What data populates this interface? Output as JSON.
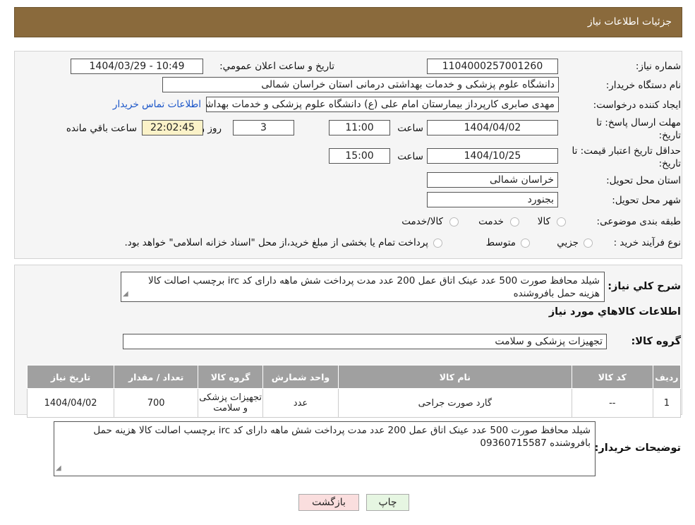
{
  "header": {
    "title": "جزئیات اطلاعات نیاز"
  },
  "fields": {
    "need_number_label": "شماره نیاز:",
    "need_number": "1104000257001260",
    "announce_label": "تاریخ و ساعت اعلان عمومي:",
    "announce_value": "1404/03/29 - 10:49",
    "buyer_org_label": "نام دستگاه خریدار:",
    "buyer_org": "دانشگاه علوم پزشکی و خدمات بهداشتی درمانی استان خراسان شمالی",
    "creator_label": "ایجاد کننده درخواست:",
    "creator": "مهدی صابری کارپرداز بیمارستان امام علی (ع) دانشگاه علوم پزشکی و خدمات بهداشتی",
    "contact_link": "اطلاعات تماس خریدار",
    "deadline_label": "مهلت ارسال پاسخ: تا تاریخ:",
    "deadline_date": "1404/04/02",
    "time_label": "ساعت",
    "deadline_time": "11:00",
    "days_value": "3",
    "days_label": "روز و",
    "remaining_time": "22:02:45",
    "remaining_label": "ساعت باقي مانده",
    "validity_label": "حداقل تاریخ اعتبار قیمت: تا تاریخ:",
    "validity_date": "1404/10/25",
    "validity_time": "15:00",
    "province_label": "استان محل تحویل:",
    "province": "خراسان شمالی",
    "city_label": "شهر محل تحویل:",
    "city": "بجنورد",
    "category_label": "طبقه بندی موضوعی:",
    "category_options": [
      "کالا",
      "خدمت",
      "کالا/خدمت"
    ],
    "process_label": "نوع فرآیند خرید :",
    "process_options": [
      "جزيي",
      "متوسط"
    ],
    "process_note": "پرداخت تمام یا بخشی از مبلغ خرید،از محل \"اسناد خزانه اسلامی\" خواهد بود."
  },
  "summary": {
    "label": "شرح کلي نیاز:",
    "text": "شیلد محافظ صورت 500 عدد عینک اتاق عمل 200 عدد  مدت پرداخت شش ماهه دارای کد irc برچسب اصالت کالا هزینه حمل بافروشنده",
    "items_heading": "اطلاعات کالاهاي مورد نیاز",
    "group_label": "گروه کالا:",
    "group_value": "تجهیزات پزشکی و سلامت"
  },
  "table": {
    "headers": [
      "رديف",
      "کد کالا",
      "نام کالا",
      "واحد شمارش",
      "گروه کالا",
      "تعداد / مقدار",
      "تاریخ نیاز"
    ],
    "rows": [
      [
        "1",
        "--",
        "گارد صورت جراحی",
        "عدد",
        "تجهیزات پزشکی و سلامت",
        "700",
        "1404/04/02"
      ]
    ]
  },
  "buyer_notes": {
    "label": "توضیحات خریدار:",
    "text": "شیلد محافظ صورت 500 عدد عینک اتاق عمل 200 عدد  مدت پرداخت شش ماهه دارای کد irc برچسب اصالت کالا هزینه حمل بافروشنده 09360715587"
  },
  "buttons": {
    "print": "چاپ",
    "back": "بازگشت"
  },
  "colors": {
    "header_bg": "#8a6a3c",
    "link": "#1a55c8",
    "print_bg": "#e6f6e2",
    "back_bg": "#fadede",
    "table_head": "#a0a0a0"
  }
}
